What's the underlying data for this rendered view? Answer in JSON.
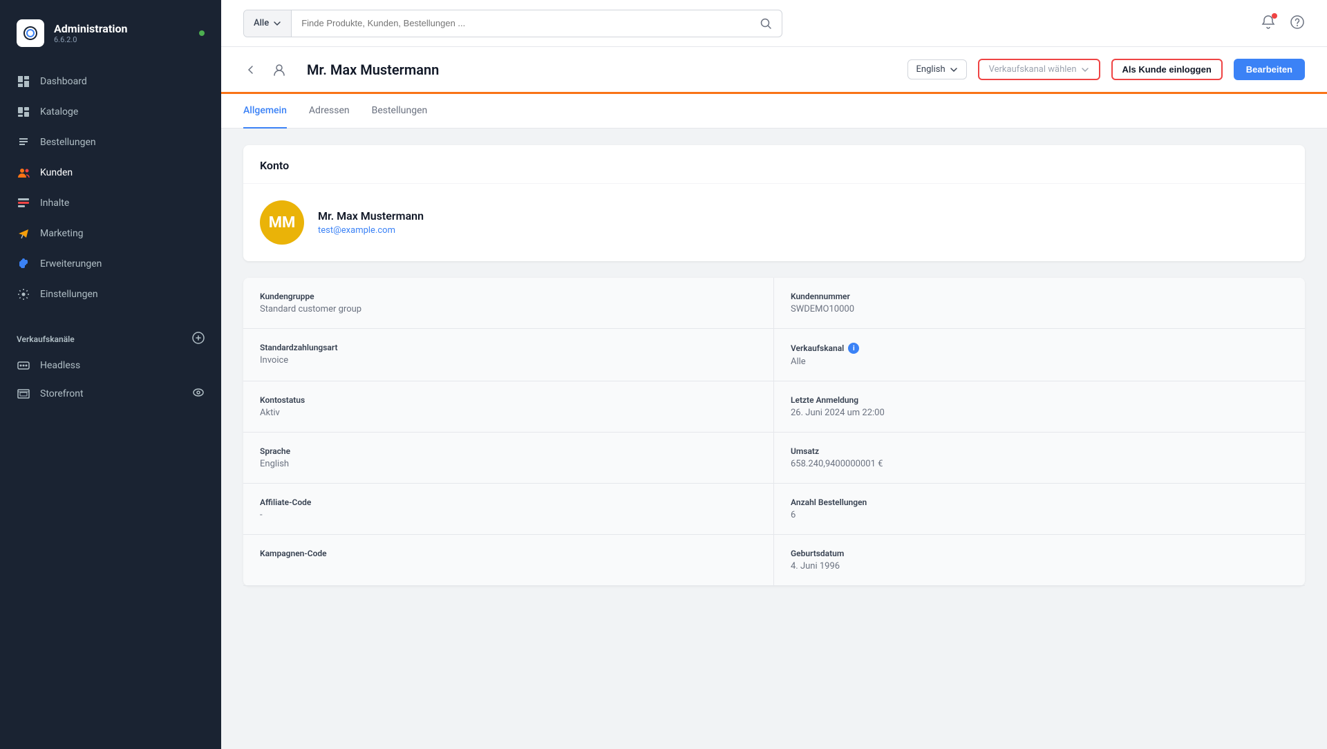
{
  "sidebar": {
    "logo": {
      "title": "Administration",
      "version": "6.6.2.0",
      "online_label": "online"
    },
    "nav_items": [
      {
        "id": "dashboard",
        "label": "Dashboard",
        "icon": "dashboard"
      },
      {
        "id": "kataloge",
        "label": "Kataloge",
        "icon": "kataloge"
      },
      {
        "id": "bestellungen",
        "label": "Bestellungen",
        "icon": "bestellungen"
      },
      {
        "id": "kunden",
        "label": "Kunden",
        "icon": "kunden",
        "active": true
      },
      {
        "id": "inhalte",
        "label": "Inhalte",
        "icon": "inhalte"
      },
      {
        "id": "marketing",
        "label": "Marketing",
        "icon": "marketing"
      },
      {
        "id": "erweiterungen",
        "label": "Erweiterungen",
        "icon": "erweiterungen"
      },
      {
        "id": "einstellungen",
        "label": "Einstellungen",
        "icon": "einstellungen"
      }
    ],
    "sales_channels_section": "Verkaufskanäle",
    "sales_channels": [
      {
        "id": "headless",
        "label": "Headless",
        "icon": "headless"
      },
      {
        "id": "storefront",
        "label": "Storefront",
        "icon": "storefront",
        "has_eye": true
      }
    ]
  },
  "topbar": {
    "search_all_label": "Alle",
    "search_placeholder": "Finde Produkte, Kunden, Bestellungen ..."
  },
  "customer_header": {
    "customer_name": "Mr. Max Mustermann",
    "language": "English",
    "sales_channel_placeholder": "Verkaufskanal wählen",
    "login_btn": "Als Kunde einloggen",
    "edit_btn": "Bearbeiten"
  },
  "tabs": [
    {
      "id": "allgemein",
      "label": "Allgemein",
      "active": true
    },
    {
      "id": "adressen",
      "label": "Adressen",
      "active": false
    },
    {
      "id": "bestellungen",
      "label": "Bestellungen",
      "active": false
    }
  ],
  "account_card": {
    "title": "Konto",
    "avatar_initials": "MM",
    "name": "Mr. Max Mustermann",
    "email": "test@example.com"
  },
  "info_fields": [
    {
      "label": "Kundengruppe",
      "value": "Standard customer group",
      "col": "left"
    },
    {
      "label": "Kundennummer",
      "value": "SWDEMO10000",
      "col": "right"
    },
    {
      "label": "Standardzahlungsart",
      "value": "Invoice",
      "col": "left"
    },
    {
      "label": "Verkaufskanal",
      "value": "Alle",
      "col": "right",
      "has_info": true
    },
    {
      "label": "Kontostatus",
      "value": "Aktiv",
      "col": "left"
    },
    {
      "label": "Letzte Anmeldung",
      "value": "26. Juni 2024 um 22:00",
      "col": "right"
    },
    {
      "label": "Sprache",
      "value": "English",
      "col": "left"
    },
    {
      "label": "Umsatz",
      "value": "658.240,9400000001 €",
      "col": "right"
    },
    {
      "label": "Affiliate-Code",
      "value": "-",
      "col": "left"
    },
    {
      "label": "Anzahl Bestellungen",
      "value": "6",
      "col": "right"
    },
    {
      "label": "Kampagnen-Code",
      "value": "",
      "col": "left"
    },
    {
      "label": "Geburtsdatum",
      "value": "4. Juni 1996",
      "col": "right"
    }
  ]
}
